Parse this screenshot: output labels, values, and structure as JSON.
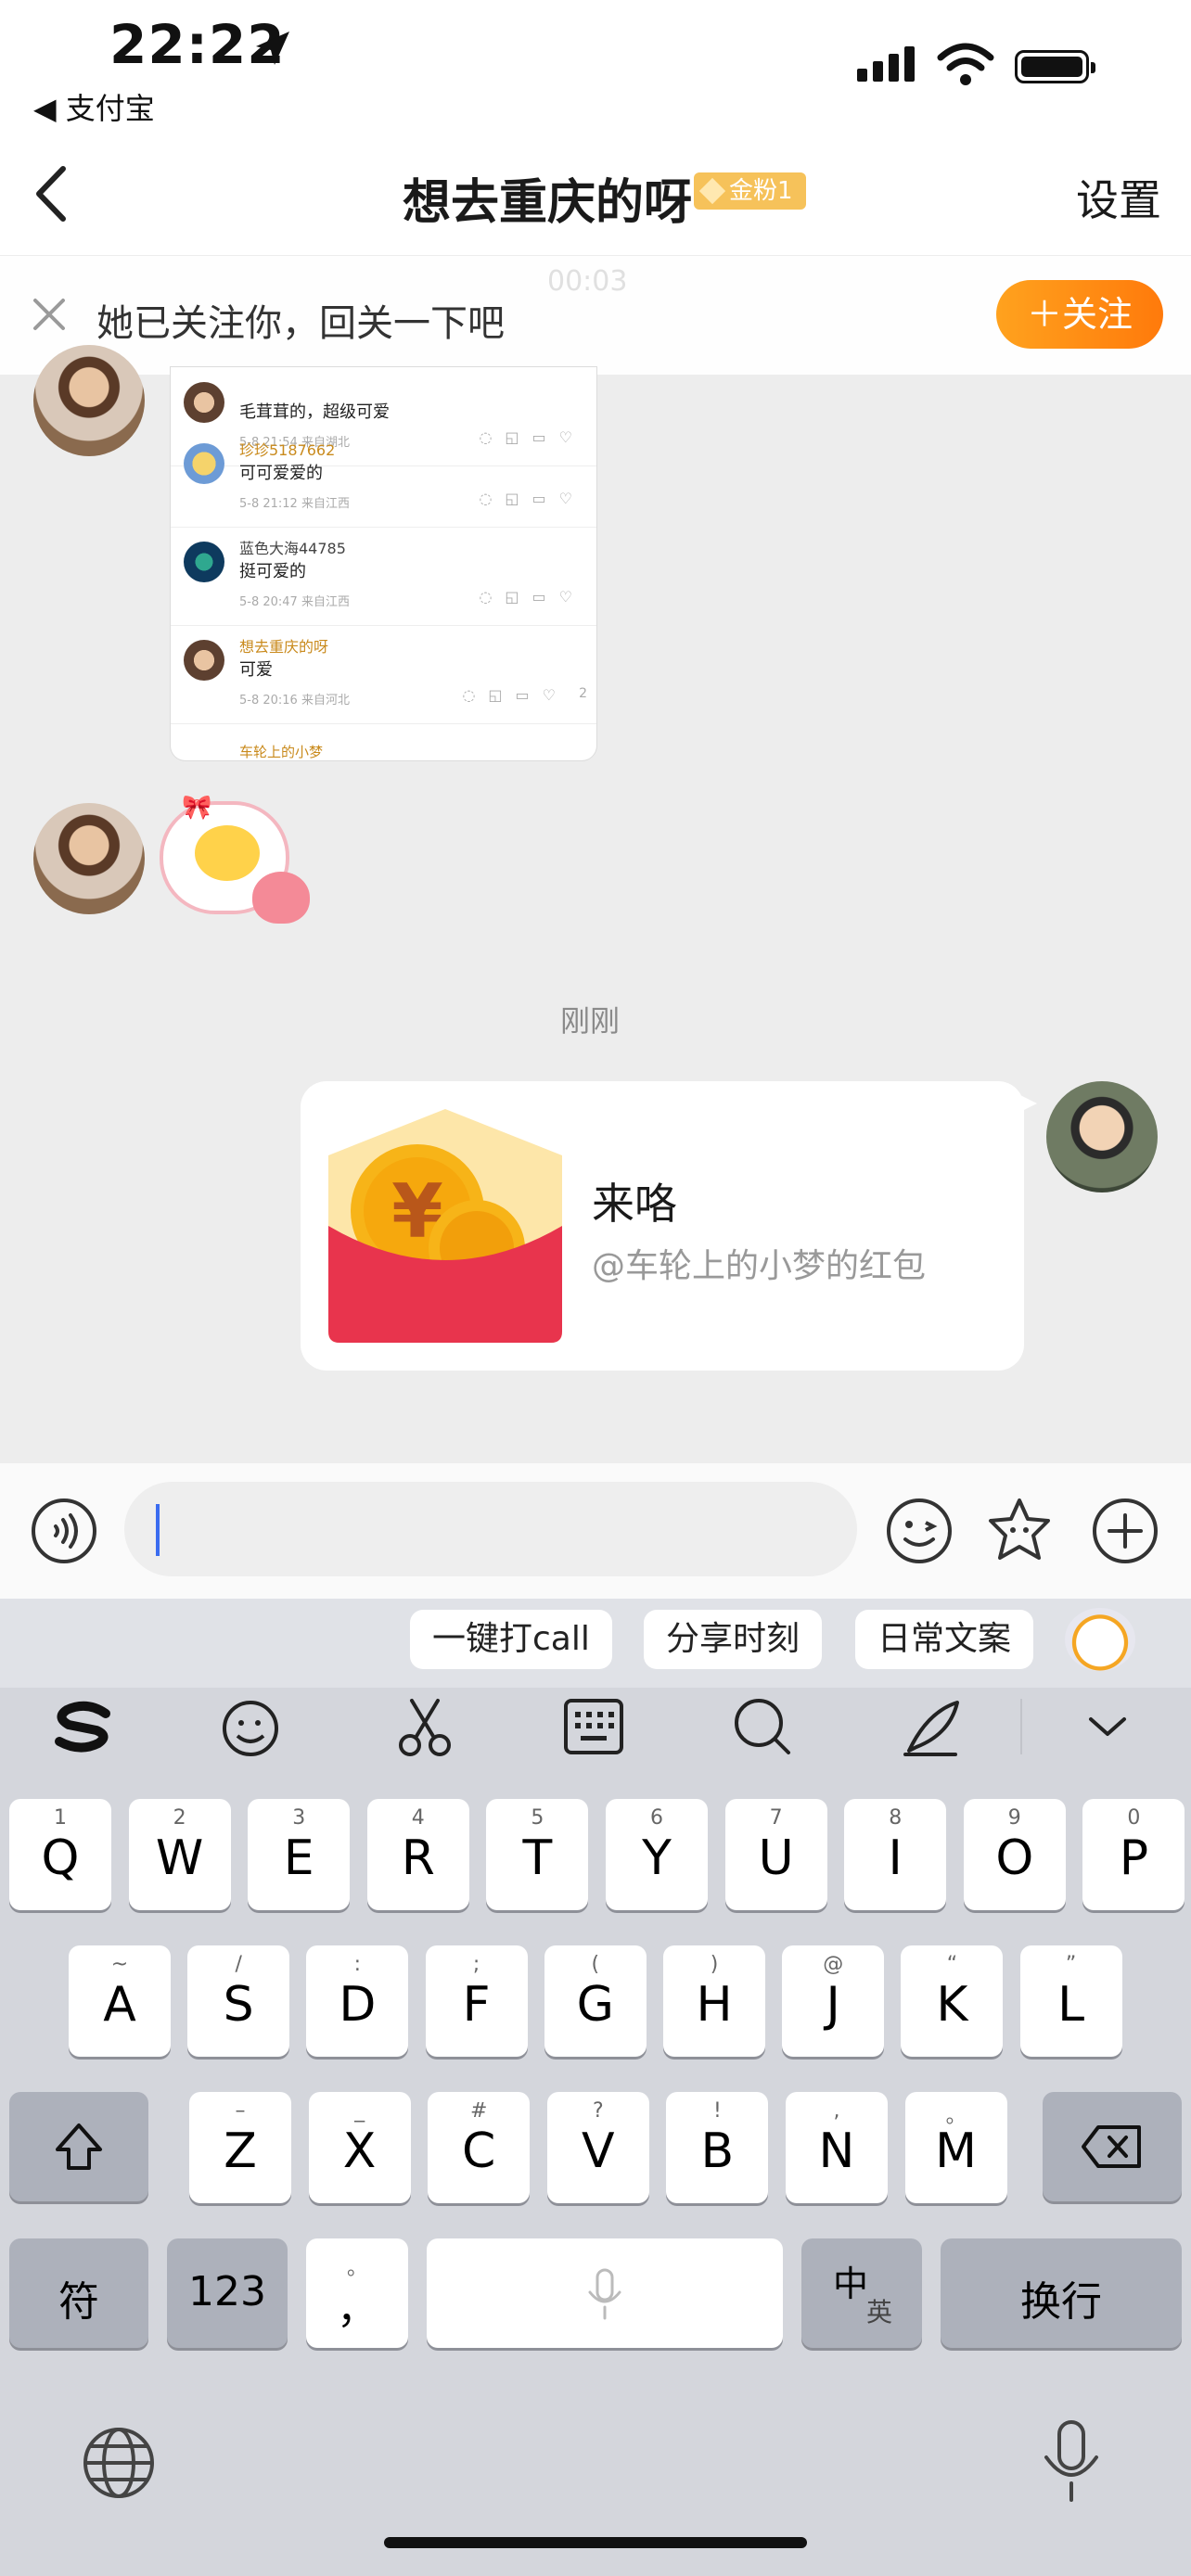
{
  "status_bar": {
    "time": "22:22",
    "back_app": "◀ 支付宝"
  },
  "nav": {
    "title": "想去重庆的呀",
    "badge": "金粉1",
    "settings": "设置"
  },
  "follow_banner": {
    "text": "她已关注你，回关一下吧",
    "button": "＋关注",
    "ghost_time": "00:03"
  },
  "screenshot_comments": [
    {
      "name": "",
      "text": "毛茸茸的，超级可爱",
      "meta": "5-8 21:54 来自湖北"
    },
    {
      "name": "珍珍5187662",
      "text": "可可爱爱的",
      "meta": "5-8 21:12 来自江西"
    },
    {
      "name": "蓝色大海44785",
      "text": "挺可爱的",
      "meta": "5-8 20:47 来自江西"
    },
    {
      "name": "想去重庆的呀",
      "text": "可爱",
      "meta": "5-8 20:16 来自河北",
      "likes": "2"
    },
    {
      "name": "车轮上的小梦",
      "text": "",
      "meta": ""
    }
  ],
  "timestamp": "刚刚",
  "red_packet": {
    "title": "来咯",
    "subtitle": "@车轮上的小梦的红包"
  },
  "suggestions": [
    "一键打call",
    "分享时刻",
    "日常文案"
  ],
  "keyboard": {
    "row1": [
      {
        "k": "Q",
        "s": "1"
      },
      {
        "k": "W",
        "s": "2"
      },
      {
        "k": "E",
        "s": "3"
      },
      {
        "k": "R",
        "s": "4"
      },
      {
        "k": "T",
        "s": "5"
      },
      {
        "k": "Y",
        "s": "6"
      },
      {
        "k": "U",
        "s": "7"
      },
      {
        "k": "I",
        "s": "8"
      },
      {
        "k": "O",
        "s": "9"
      },
      {
        "k": "P",
        "s": "0"
      }
    ],
    "row2": [
      {
        "k": "A",
        "s": "~"
      },
      {
        "k": "S",
        "s": "/"
      },
      {
        "k": "D",
        "s": ":"
      },
      {
        "k": "F",
        "s": ";"
      },
      {
        "k": "G",
        "s": "("
      },
      {
        "k": "H",
        "s": ")"
      },
      {
        "k": "J",
        "s": "@"
      },
      {
        "k": "K",
        "s": "“"
      },
      {
        "k": "L",
        "s": "”"
      }
    ],
    "row3": [
      {
        "k": "Z",
        "s": "–"
      },
      {
        "k": "X",
        "s": "_"
      },
      {
        "k": "C",
        "s": "#"
      },
      {
        "k": "V",
        "s": "?"
      },
      {
        "k": "B",
        "s": "!"
      },
      {
        "k": "N",
        "s": ","
      },
      {
        "k": "M",
        "s": "。"
      }
    ],
    "fu": "符",
    "num": "123",
    "comma": "，",
    "comma_sub": "。",
    "zh": "中",
    "en": "英",
    "enter": "换行"
  }
}
